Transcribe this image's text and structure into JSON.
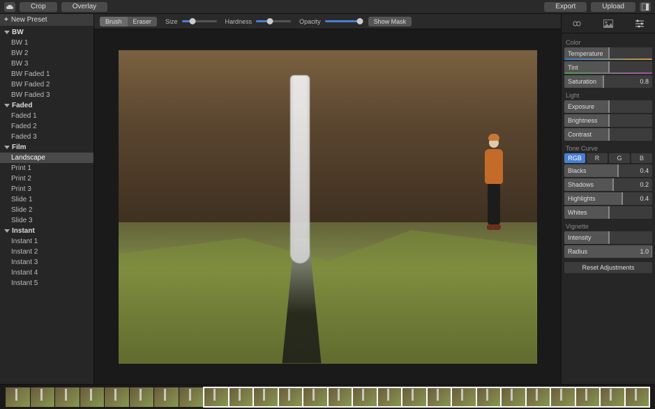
{
  "topbar": {
    "crop": "Crop",
    "overlay": "Overlay",
    "export": "Export",
    "upload": "Upload"
  },
  "sidebar": {
    "new_preset": "New Preset",
    "groups": [
      {
        "name": "BW",
        "items": [
          "BW 1",
          "BW 2",
          "BW 3",
          "BW Faded 1",
          "BW Faded 2",
          "BW Faded 3"
        ]
      },
      {
        "name": "Faded",
        "items": [
          "Faded 1",
          "Faded 2",
          "Faded 3"
        ]
      },
      {
        "name": "Film",
        "items": [
          "Landscape",
          "Print 1",
          "Print 2",
          "Print 3",
          "Slide 1",
          "Slide 2",
          "Slide 3"
        ]
      },
      {
        "name": "Instant",
        "items": [
          "Instant 1",
          "Instant 2",
          "Instant 3",
          "Instant 4",
          "Instant 5"
        ]
      }
    ],
    "selected": "Landscape"
  },
  "brushbar": {
    "brush": "Brush",
    "eraser": "Eraser",
    "size": "Size",
    "hardness": "Hardness",
    "opacity": "Opacity",
    "showmask": "Show Mask",
    "size_val": 0.3,
    "hardness_val": 0.4,
    "opacity_val": 1.0
  },
  "adjust": {
    "color_section": "Color",
    "temperature": "Temperature",
    "tint": "Tint",
    "saturation": "Saturation",
    "saturation_val": "0.8",
    "light_section": "Light",
    "exposure": "Exposure",
    "brightness": "Brightness",
    "contrast": "Contrast",
    "tone_section": "Tone Curve",
    "rgb": "RGB",
    "r": "R",
    "g": "G",
    "b": "B",
    "blacks": "Blacks",
    "blacks_val": "0.4",
    "shadows": "Shadows",
    "shadows_val": "0.2",
    "highlights": "Highlights",
    "highlights_val": "0.4",
    "whites": "Whites",
    "vignette_section": "Vignette",
    "intensity": "Intensity",
    "radius": "Radius",
    "radius_val": "1.0",
    "reset": "Reset Adjustments"
  },
  "filmstrip": {
    "frame_count": 26,
    "highlight_start": 8,
    "highlight_end": 26
  }
}
